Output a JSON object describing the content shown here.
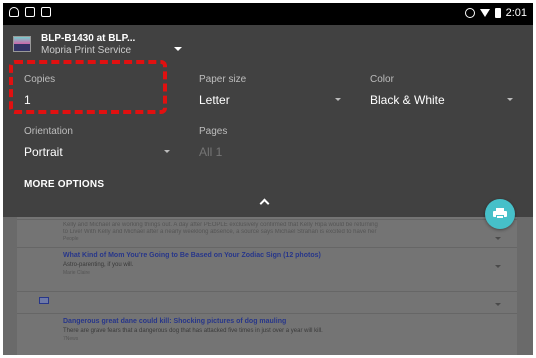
{
  "status_bar": {
    "time": "2:01"
  },
  "printer": {
    "name": "BLP-B1430  at BLP...",
    "service": "Mopria Print Service"
  },
  "fields": {
    "copies": {
      "label": "Copies",
      "value": "1"
    },
    "paper_size": {
      "label": "Paper size",
      "value": "Letter"
    },
    "color": {
      "label": "Color",
      "value": "Black & White"
    },
    "orientation": {
      "label": "Orientation",
      "value": "Portrait"
    },
    "pages": {
      "label": "Pages",
      "value": "All 1"
    }
  },
  "more_options": "MORE OPTIONS",
  "preview": {
    "snippet_line1": "Kelly and Michael are working things out. A day after PEOPLE exclusively confirmed that Kelly Ripa would be returning",
    "snippet_line2": "to Live! With Kelly and Michael after a nearly weeklong absence, a source says Michael Strahan is excited to have her",
    "snippet_source": "People",
    "articles": [
      {
        "title": "What Kind of Mom You're Going to Be Based on Your Zodiac Sign (12 photos)",
        "desc": "Astro-parenting, if you will.",
        "source": "Marie Claire"
      },
      {
        "title": "Dangerous great dane could kill: Shocking pictures of dog mauling",
        "desc": "There are grave fears that a dangerous dog that has attacked five times in just over a year will kill.",
        "source": "7News"
      }
    ]
  },
  "colors": {
    "dialog_bg": "#414141",
    "fab": "#46c0c9",
    "highlight": "#e11010",
    "link": "#27368a"
  }
}
